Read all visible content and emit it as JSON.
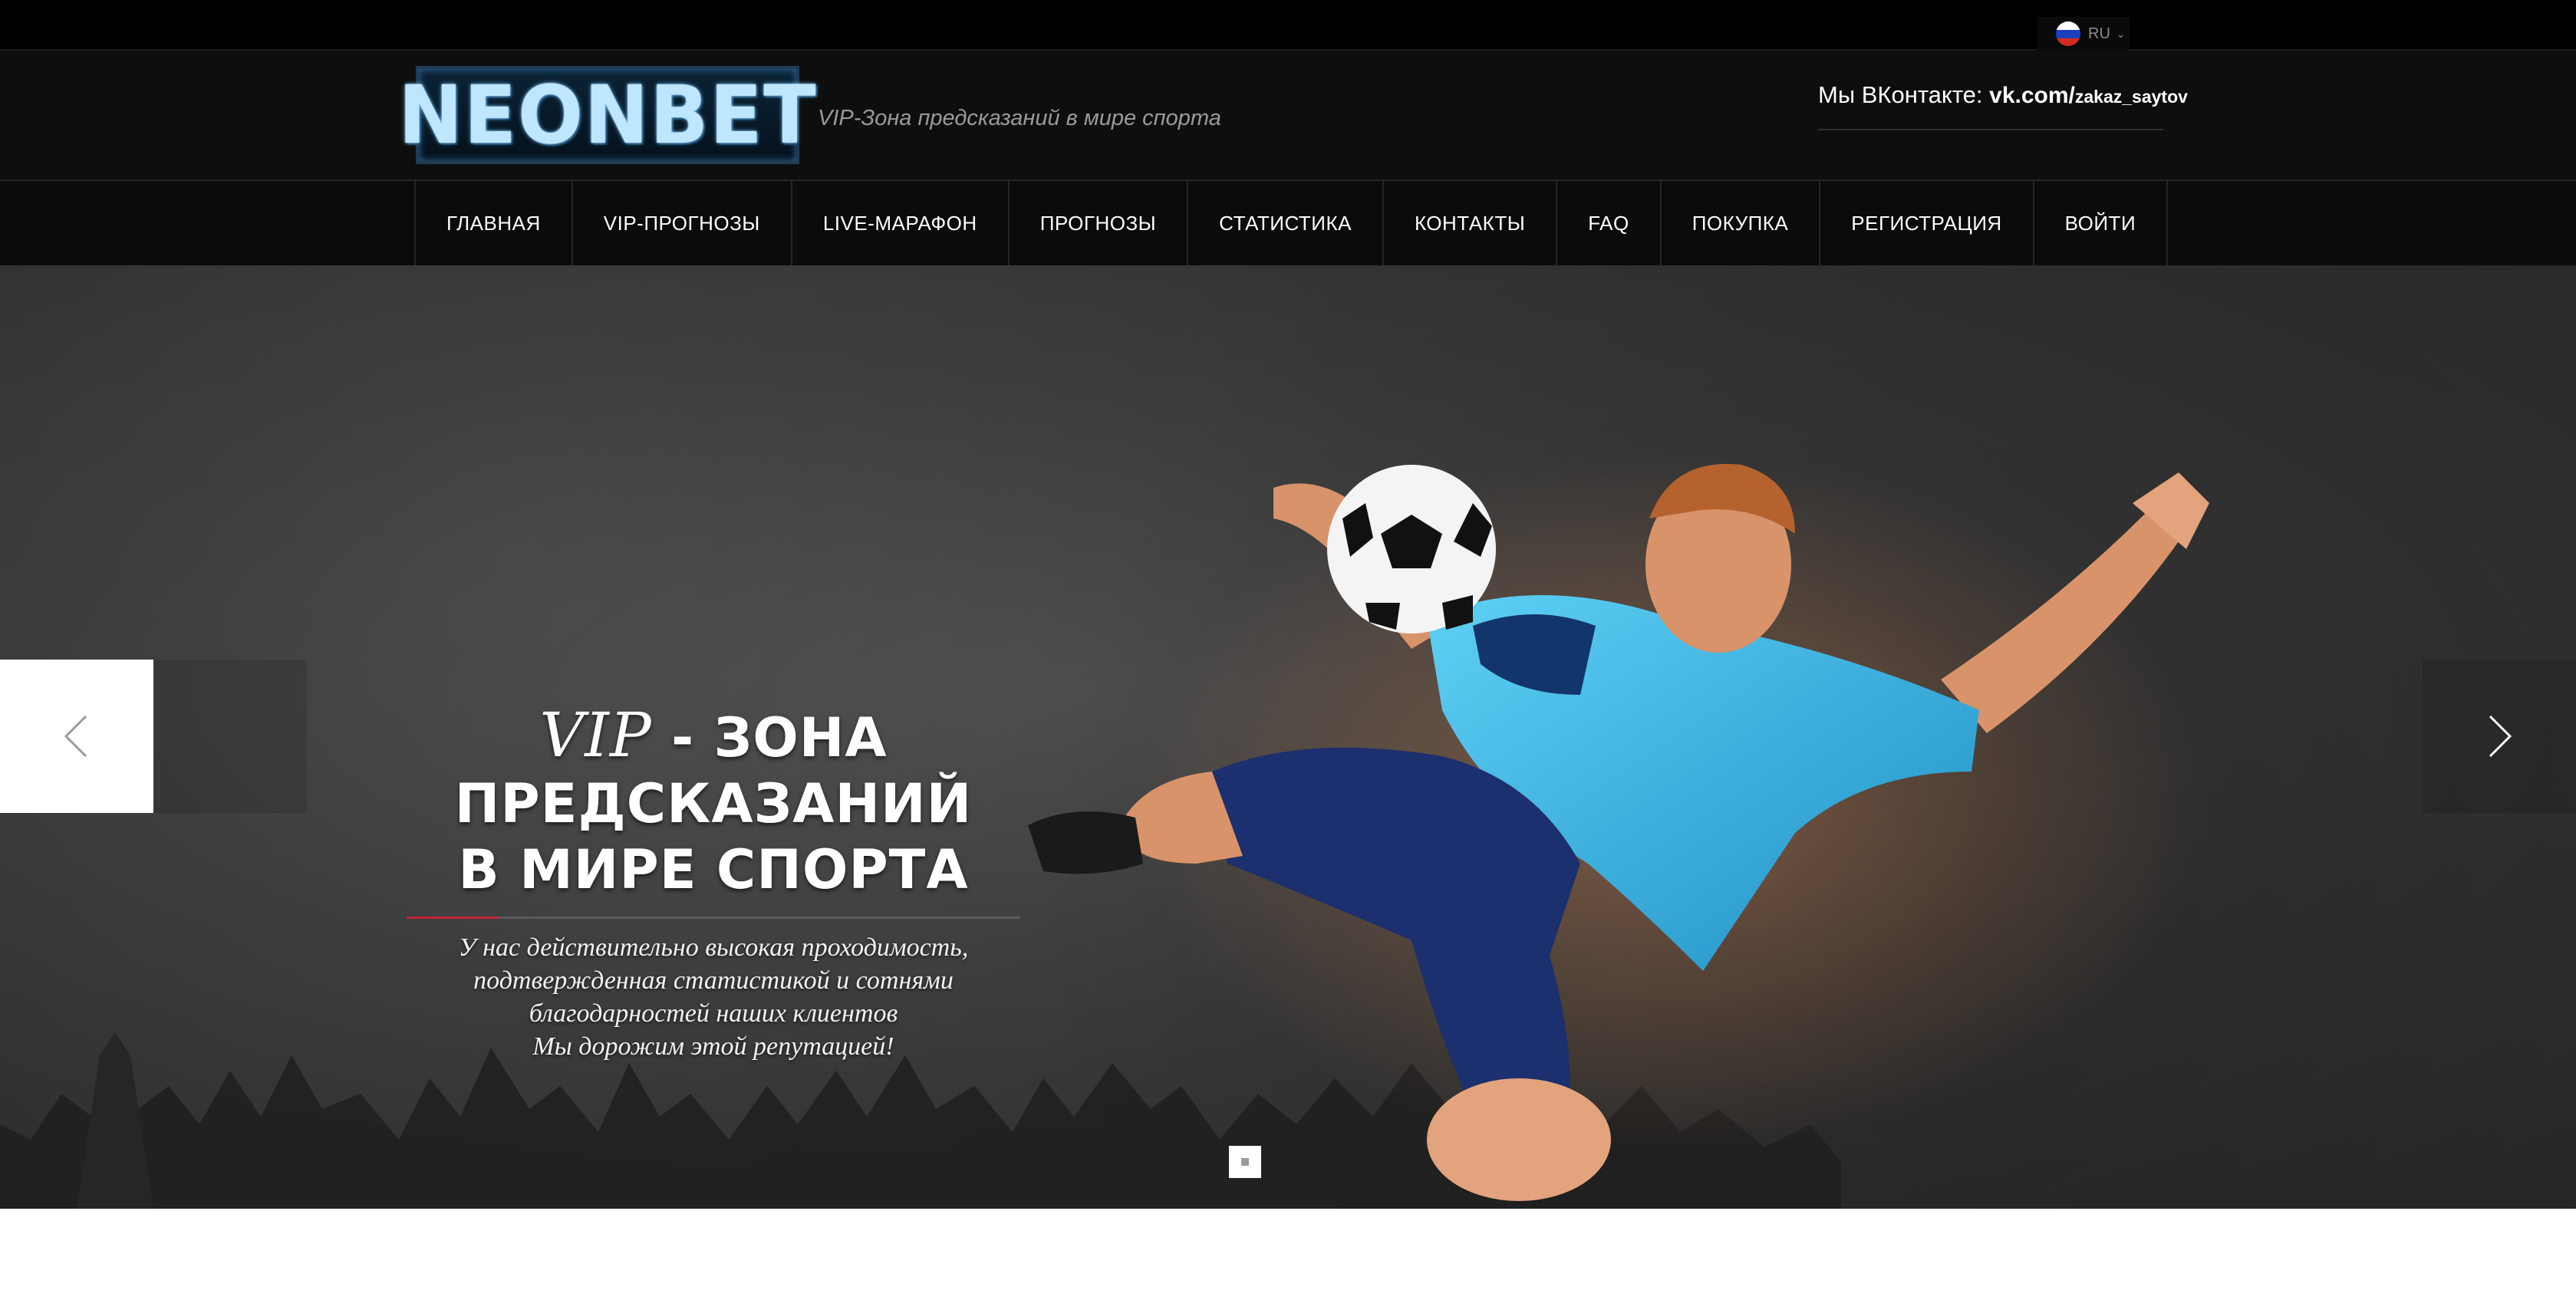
{
  "topbar": {
    "language": {
      "code": "RU",
      "icon": "russia-flag-icon"
    }
  },
  "header": {
    "logo_text": "NEONBET",
    "tagline": "VIP-Зона предсказаний в мире спорта",
    "vk_label": "Мы ВКонтакте: ",
    "vk_domain": "vk.com/",
    "vk_handle": "zakaz_saytov"
  },
  "nav": {
    "items": [
      {
        "label": "ГЛАВНАЯ"
      },
      {
        "label": "VIP-ПРОГНОЗЫ"
      },
      {
        "label": "LIVE-МАРАФОН"
      },
      {
        "label": "ПРОГНОЗЫ"
      },
      {
        "label": "СТАТИСТИКА"
      },
      {
        "label": "КОНТАКТЫ"
      },
      {
        "label": "FAQ"
      },
      {
        "label": "ПОКУПКА"
      },
      {
        "label": "РЕГИСТРАЦИЯ"
      },
      {
        "label": "ВОЙТИ"
      }
    ]
  },
  "slider": {
    "title_vip": "VIP",
    "title_rest": " - ЗОНА",
    "title_line2": "ПРЕДСКАЗАНИЙ",
    "title_line3": "В МИРЕ СПОРТА",
    "subtitle_lines": [
      "У нас действительно высокая проходимость,",
      "подтвержденная статистикой и сотнями",
      "благодарностей наших клиентов",
      "Мы дорожим этой репутацией!"
    ],
    "prev_icon": "chevron-left-icon",
    "next_icon": "chevron-right-icon",
    "accent_color": "#c0243a"
  }
}
